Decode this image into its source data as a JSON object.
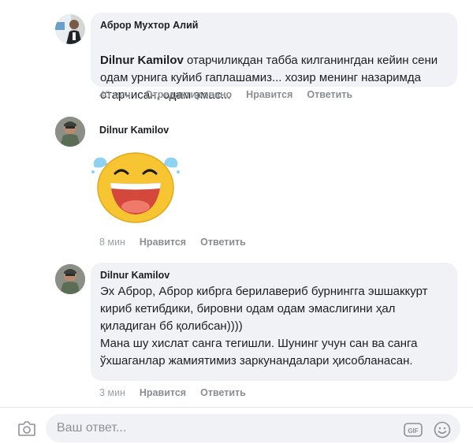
{
  "comments": [
    {
      "author": "Аброр Мухтор Алий",
      "mention": "Dilnur Kamilov",
      "text": " отарчиликдан табба килганингдан кейин сени одам урнига куйиб гаплашамиз... хозир менинг назаримда отарчисан, одам эмас...",
      "time": "40 мин",
      "edited": "Отредактировано",
      "like": "Нравится",
      "reply": "Ответить"
    },
    {
      "author": "Dilnur Kamilov",
      "sticker": "laughing-tears-sticker",
      "time": "8 мин",
      "like": "Нравится",
      "reply": "Ответить"
    },
    {
      "author": "Dilnur Kamilov",
      "text": "Эх Аброр, Аброр кибрга берилавериб бурнингга эшшаккурт кириб кетибдики, бировни одам одам эмаслигини ҳал қиладиган бб қолибсан))))\nМана шу хислат сангa тегишли. Шунинг учун сан ва санга ўхшаганлар жамиятимиз заркунандалари ҳисобланасан.",
      "time": "3 мин",
      "like": "Нравится",
      "reply": "Ответить"
    }
  ],
  "composer": {
    "placeholder": "Ваш ответ...",
    "camera_icon": "camera-icon",
    "gif_icon": "gif-icon",
    "emoji_icon": "emoji-icon"
  },
  "colors": {
    "bubble": "#f0f2f5",
    "meta_text": "#8a8d91",
    "sticker_yellow": "#f7c531",
    "tear_blue": "#8fd1f1"
  }
}
